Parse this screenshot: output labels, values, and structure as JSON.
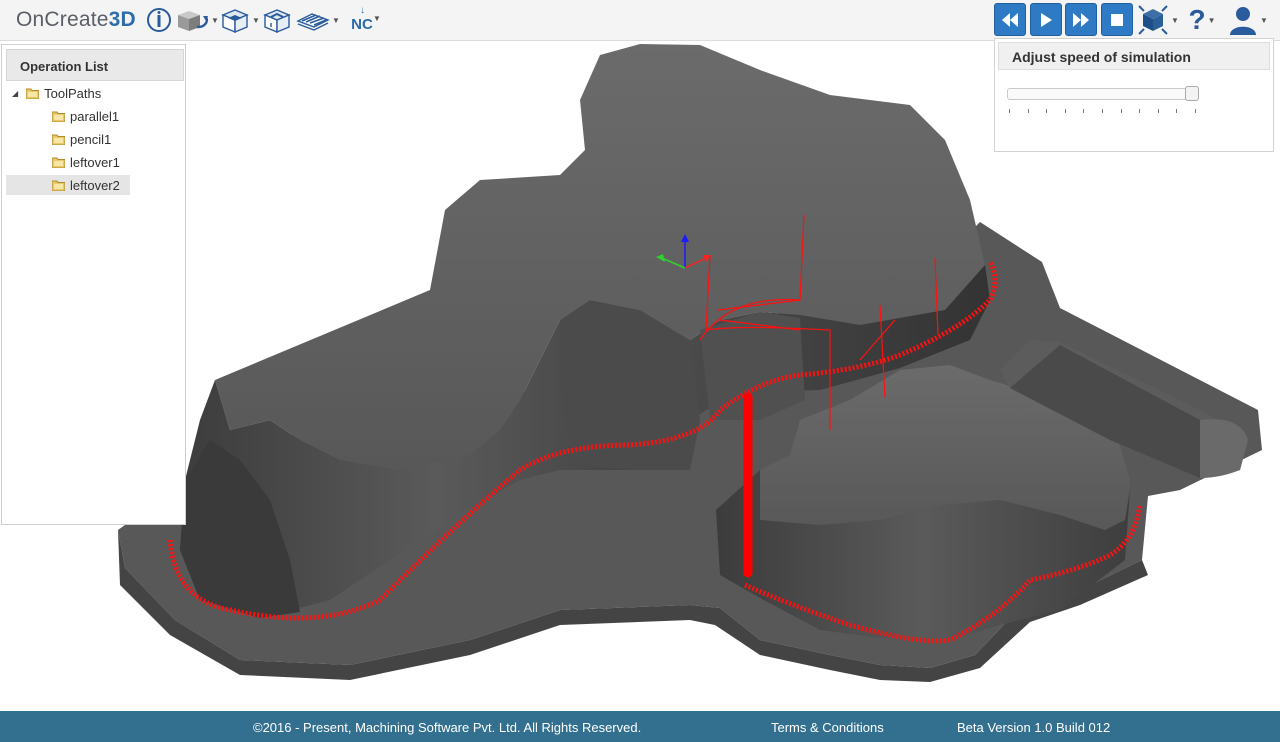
{
  "app": {
    "logo_main": "OnCreate",
    "logo_accent": "3D"
  },
  "toolbar": {
    "tools": [
      {
        "icon": "info-icon",
        "has_dropdown": false
      },
      {
        "icon": "view-rotate-icon",
        "has_dropdown": true
      },
      {
        "icon": "stock-box-icon",
        "has_dropdown": true
      },
      {
        "icon": "part-box-icon",
        "has_dropdown": true
      },
      {
        "icon": "toolpath-layers-icon",
        "has_dropdown": true
      }
    ],
    "nc_label": "NC",
    "sim_controls": [
      "rewind-icon",
      "play-icon",
      "fast-forward-icon",
      "stop-icon"
    ],
    "right_icons": [
      "view-cube-icon",
      "help-icon",
      "user-icon"
    ],
    "help_label": "?"
  },
  "operation_panel": {
    "title": "Operation List",
    "root": {
      "label": "ToolPaths",
      "expanded": true
    },
    "items": [
      {
        "label": "parallel1"
      },
      {
        "label": "pencil1"
      },
      {
        "label": "leftover1"
      },
      {
        "label": "leftover2",
        "selected": true
      }
    ]
  },
  "speed_panel": {
    "title": "Adjust speed of simulation",
    "slider": {
      "value": 1.0,
      "tick_count": 11
    }
  },
  "colors": {
    "brand": "#2f6da8",
    "sim_button": "#2f7ac4",
    "footer": "#33708f",
    "toolpath": "#ff0000",
    "model": "#5c5c5c"
  },
  "footer": {
    "copyright": "©2016 - Present, Machining Software Pvt. Ltd. All Rights Reserved.",
    "terms": "Terms & Conditions",
    "version": "Beta Version 1.0 Build 012"
  }
}
